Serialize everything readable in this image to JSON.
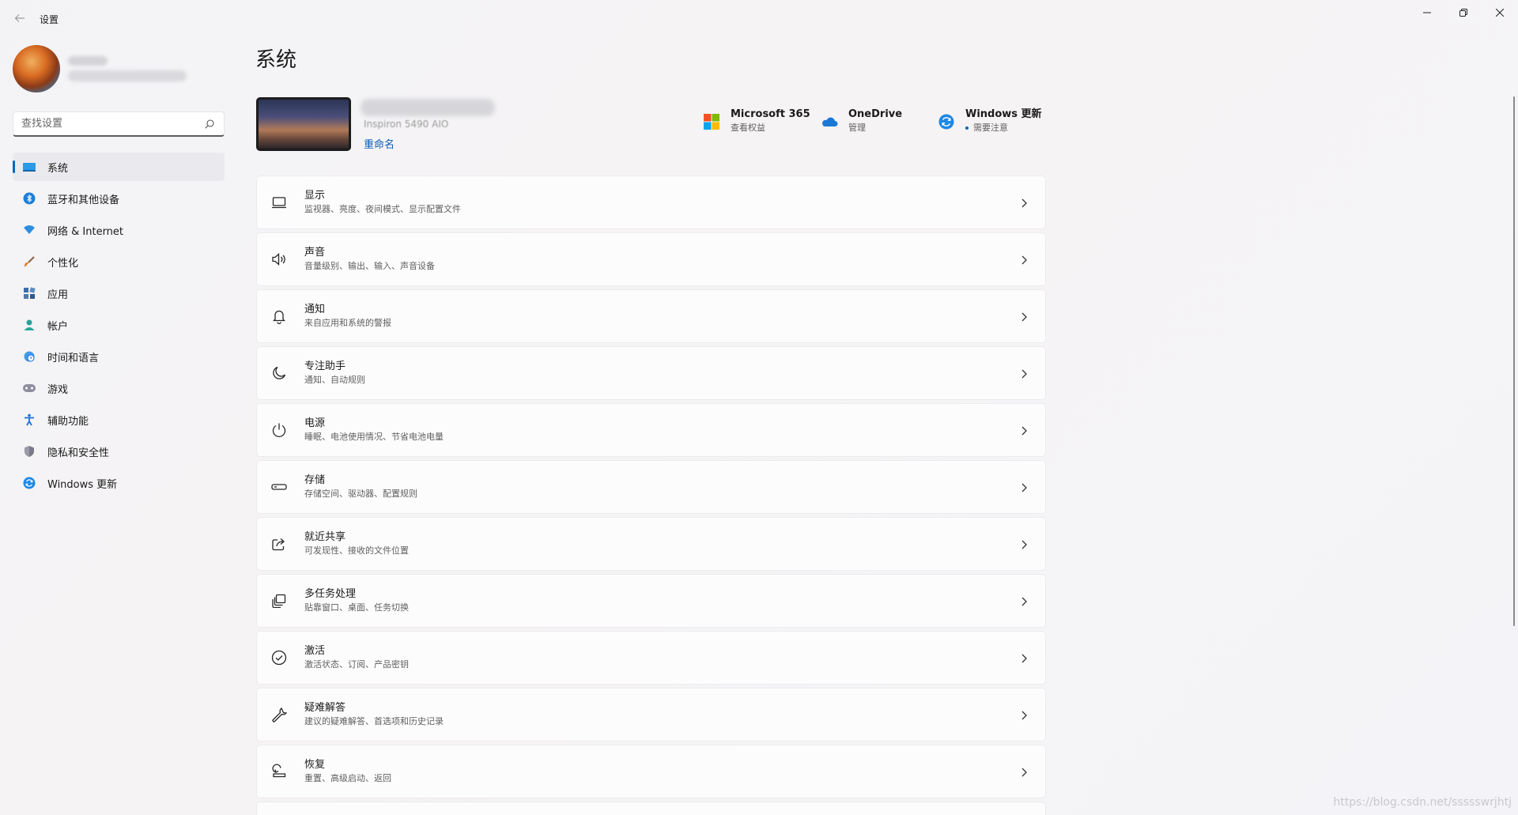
{
  "window": {
    "title": "设置",
    "back_icon": "back-arrow-icon",
    "controls": [
      "minimize-icon",
      "restore-icon",
      "close-icon"
    ]
  },
  "sidebar": {
    "search": {
      "placeholder": "查找设置",
      "value": ""
    },
    "items": [
      {
        "label": "系统",
        "icon": "system-icon",
        "color": "#0078d4",
        "selected": true
      },
      {
        "label": "蓝牙和其他设备",
        "icon": "bluetooth-icon",
        "color": "#0078d4"
      },
      {
        "label": "网络 & Internet",
        "icon": "wifi-icon",
        "color": "#1e88e5"
      },
      {
        "label": "个性化",
        "icon": "brush-icon",
        "color": "#e07020"
      },
      {
        "label": "应用",
        "icon": "apps-icon",
        "color": "#4a6a8a"
      },
      {
        "label": "帐户",
        "icon": "account-icon",
        "color": "#2aa198"
      },
      {
        "label": "时间和语言",
        "icon": "globe-clock-icon",
        "color": "#1e88e5"
      },
      {
        "label": "游戏",
        "icon": "gamepad-icon",
        "color": "#7a7a8a"
      },
      {
        "label": "辅助功能",
        "icon": "accessibility-icon",
        "color": "#1e6fd9"
      },
      {
        "label": "隐私和安全性",
        "icon": "shield-icon",
        "color": "#6a6a7a"
      },
      {
        "label": "Windows 更新",
        "icon": "update-icon",
        "color": "#1e88e5"
      }
    ]
  },
  "main": {
    "title": "系统",
    "device": {
      "model": "Inspiron 5490 AIO",
      "rename_label": "重命名"
    },
    "quick_links": [
      {
        "title": "Microsoft 365",
        "subtitle": "查看权益",
        "icon": "microsoft-logo-icon"
      },
      {
        "title": "OneDrive",
        "subtitle": "管理",
        "icon": "onedrive-cloud-icon"
      },
      {
        "title": "Windows 更新",
        "subtitle": "需要注意",
        "icon": "windows-update-icon"
      }
    ],
    "settings": [
      {
        "title": "显示",
        "subtitle": "监视器、亮度、夜间模式、显示配置文件",
        "icon": "display-icon"
      },
      {
        "title": "声音",
        "subtitle": "音量级别、输出、输入、声音设备",
        "icon": "speaker-icon"
      },
      {
        "title": "通知",
        "subtitle": "来自应用和系统的警报",
        "icon": "bell-icon"
      },
      {
        "title": "专注助手",
        "subtitle": "通知、自动规则",
        "icon": "moon-icon"
      },
      {
        "title": "电源",
        "subtitle": "睡眠、电池使用情况、节省电池电量",
        "icon": "power-icon"
      },
      {
        "title": "存储",
        "subtitle": "存储空间、驱动器、配置规则",
        "icon": "storage-icon"
      },
      {
        "title": "就近共享",
        "subtitle": "可发现性、接收的文件位置",
        "icon": "share-icon"
      },
      {
        "title": "多任务处理",
        "subtitle": "贴靠窗口、桌面、任务切换",
        "icon": "multitask-icon"
      },
      {
        "title": "激活",
        "subtitle": "激活状态、订阅、产品密钥",
        "icon": "check-circle-icon"
      },
      {
        "title": "疑难解答",
        "subtitle": "建议的疑难解答、首选项和历史记录",
        "icon": "wrench-icon"
      },
      {
        "title": "恢复",
        "subtitle": "重置、高级启动、返回",
        "icon": "recovery-icon"
      }
    ]
  },
  "watermark": "https://blog.csdn.net/ssssswrjhtj"
}
